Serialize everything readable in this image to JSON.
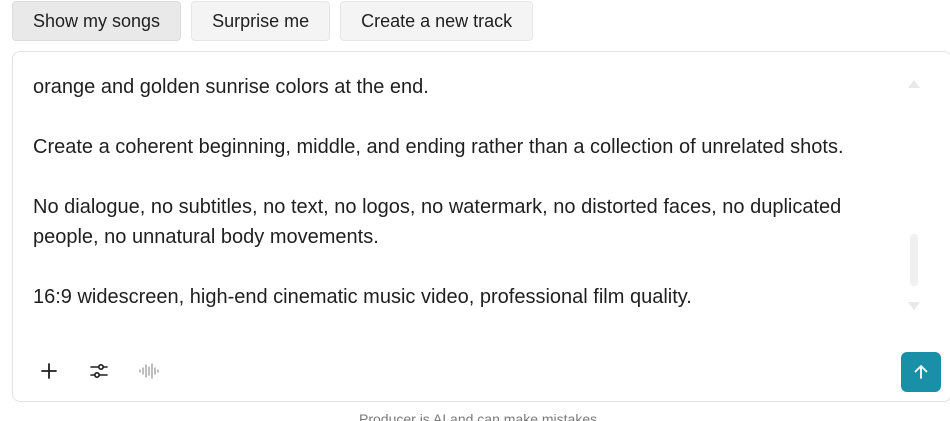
{
  "chips": [
    {
      "label": "Show my songs"
    },
    {
      "label": "Surprise me"
    },
    {
      "label": "Create a new track"
    }
  ],
  "composer": {
    "paragraphs": [
      "orange and golden sunrise colors at the end.",
      "Create a coherent beginning, middle, and ending rather than a collection of unrelated shots.",
      "No dialogue, no subtitles, no text, no logos, no watermark, no distorted faces, no duplicated people, no unnatural body movements.",
      "16:9 widescreen, high-end cinematic music video, professional film quality."
    ],
    "tools": {
      "plus_icon": "plus-icon",
      "tune_icon": "tune-icon",
      "waveform_icon": "waveform-icon",
      "send_icon": "arrow-up-icon"
    }
  },
  "footer": {
    "disclaimer": "Producer is AI and can make mistakes."
  },
  "colors": {
    "send_button": "#1a8fa8",
    "chip_background": "#f4f4f4",
    "text": "#1f1f1f"
  }
}
